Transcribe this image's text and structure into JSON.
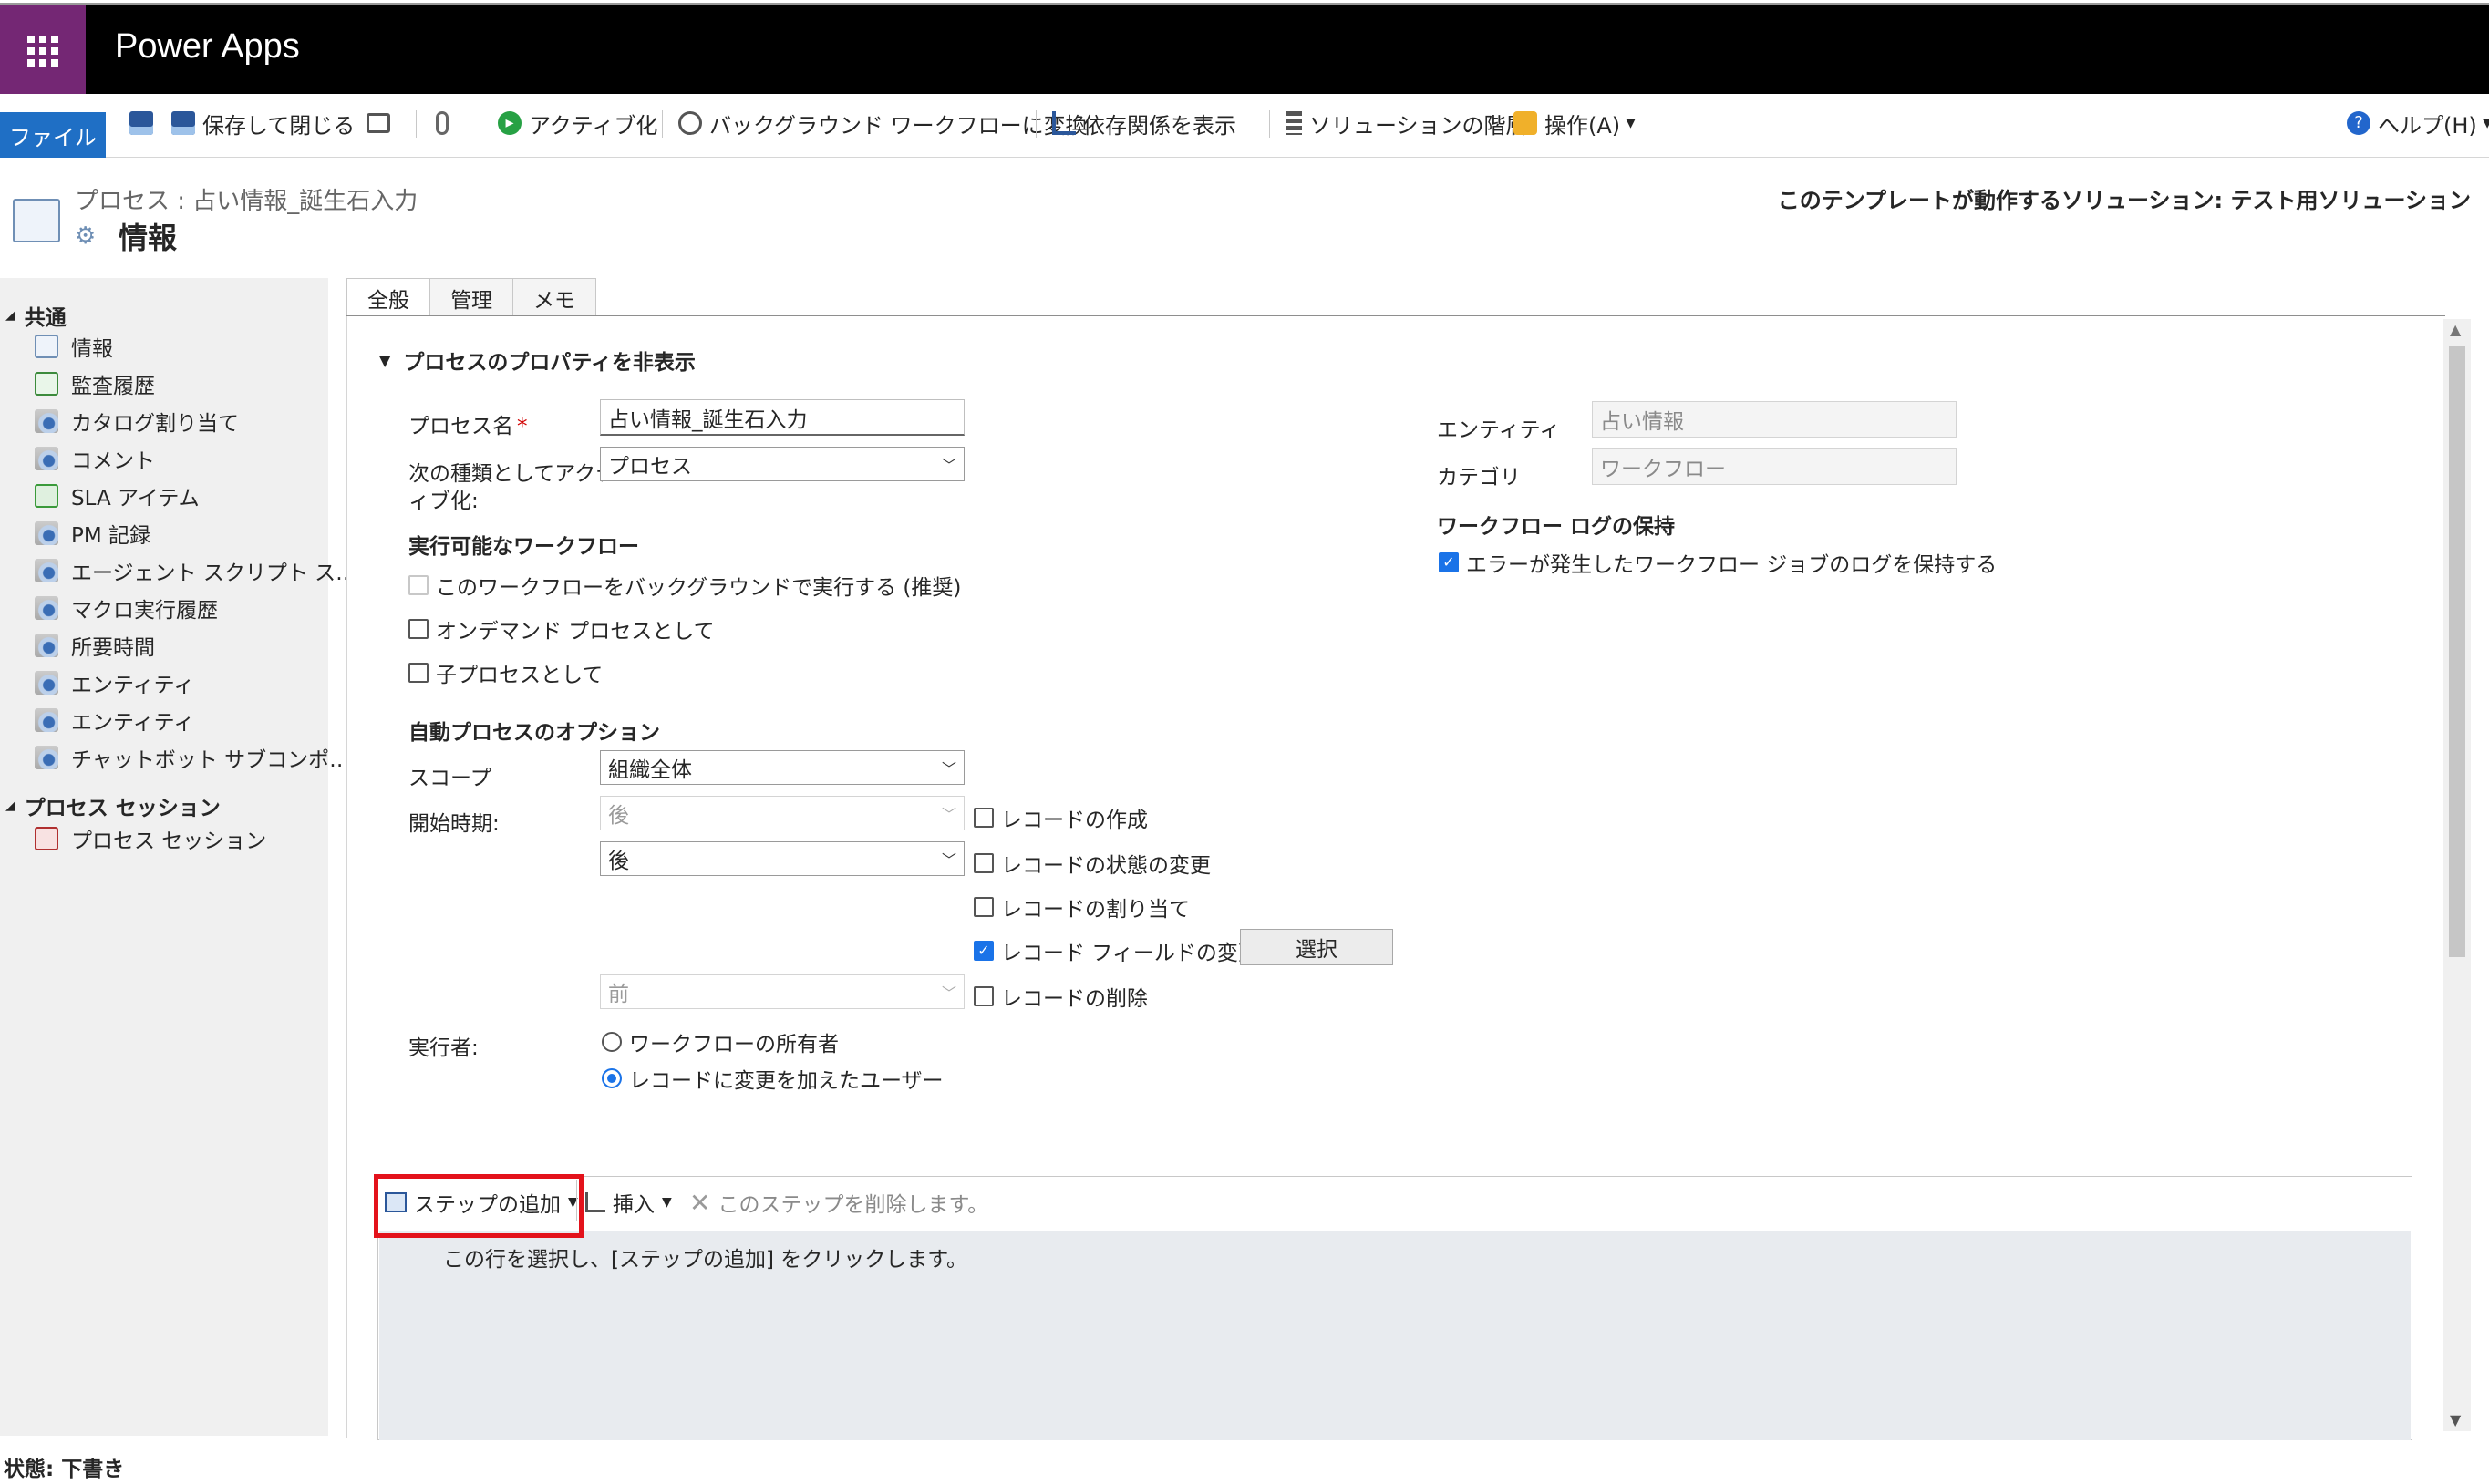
{
  "app": {
    "title": "Power Apps"
  },
  "ribbon": {
    "file": "ファイル",
    "save_close": "保存して閉じる",
    "activate": "アクティブ化",
    "convert": "バックグラウンド ワークフローに変換",
    "show_dependencies": "依存関係を表示",
    "solution_layers": "ソリューションの階層",
    "actions": "操作(A)",
    "help": "ヘルプ(H)"
  },
  "header": {
    "breadcrumb": "プロセス : 占い情報_誕生石入力",
    "title": "情報",
    "solution_note": "このテンプレートが動作するソリューション: テスト用ソリューション"
  },
  "nav": {
    "common_section": "共通",
    "items": [
      "情報",
      "監査履歴",
      "カタログ割り当て",
      "コメント",
      "SLA アイテム",
      "PM 記録",
      "エージェント スクリプト ス…",
      "マクロ実行履歴",
      "所要時間",
      "エンティティ",
      "エンティティ",
      "チャットボット サブコンポ…"
    ],
    "session_section": "プロセス セッション",
    "session_items": [
      "プロセス セッション"
    ]
  },
  "tabs": [
    "全般",
    "管理",
    "メモ"
  ],
  "form": {
    "section_toggle": "プロセスのプロパティを非表示",
    "process_name_label": "プロセス名",
    "required_mark": "*",
    "process_name_value": "占い情報_誕生石入力",
    "activate_as_label_1": "次の種類としてアクテ",
    "activate_as_label_2": "ィブ化:",
    "activate_as_value": "プロセス",
    "available_workflow_heading": "実行可能なワークフロー",
    "run_background": "このワークフローをバックグラウンドで実行する (推奨)",
    "on_demand": "オンデマンド プロセスとして",
    "child_process": "子プロセスとして",
    "auto_options_heading": "自動プロセスのオプション",
    "scope_label": "スコープ",
    "scope_value": "組織全体",
    "start_when_label": "開始時期:",
    "start_after_1": "後",
    "start_after_2": "後",
    "start_before": "前",
    "record_create": "レコードの作成",
    "record_status_change": "レコードの状態の変更",
    "record_assign": "レコードの割り当て",
    "record_field_change": "レコード フィールドの変更",
    "select_button": "選択",
    "record_delete": "レコードの削除",
    "run_as_label": "実行者:",
    "run_as_owner": "ワークフローの所有者",
    "run_as_user": "レコードに変更を加えたユーザー",
    "entity_label": "エンティティ",
    "entity_value": "占い情報",
    "category_label": "カテゴリ",
    "category_value": "ワークフロー",
    "log_heading": "ワークフロー ログの保持",
    "log_keep": "エラーが発生したワークフロー ジョブのログを保持する"
  },
  "steps": {
    "add_step": "ステップの追加",
    "insert": "挿入",
    "delete_step": "このステップを削除します。",
    "hint": "この行を選択し、[ステップの追加] をクリックします。"
  },
  "status": {
    "text": "状態: 下書き"
  },
  "colors": {
    "app_bar": "#000000",
    "waffle": "#742774",
    "file_tab": "#1f6fc5",
    "highlight": "#e3121b",
    "check": "#1a73e8"
  }
}
